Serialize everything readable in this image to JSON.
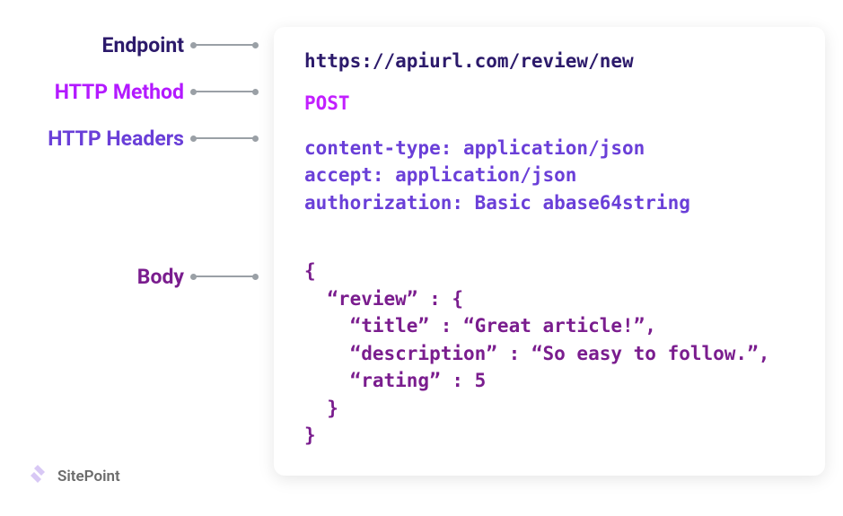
{
  "labels": {
    "endpoint": "Endpoint",
    "method": "HTTP Method",
    "headers": "HTTP Headers",
    "body": "Body"
  },
  "request": {
    "endpoint": "https://apiurl.com/review/new",
    "method": "POST",
    "headers": "content-type: application/json\naccept: application/json\nauthorization: Basic abase64string",
    "body": "{\n  “review” : {\n    “title” : “Great article!”,\n    “description” : “So easy to follow.”,\n    “rating” : 5\n  }\n}"
  },
  "brand": {
    "name": "SitePoint"
  },
  "colors": {
    "endpoint": "#2c1a6b",
    "method": "#c21fff",
    "headers": "#6a3fd8",
    "body": "#7a1d8e",
    "connector": "#9aa0a6"
  }
}
